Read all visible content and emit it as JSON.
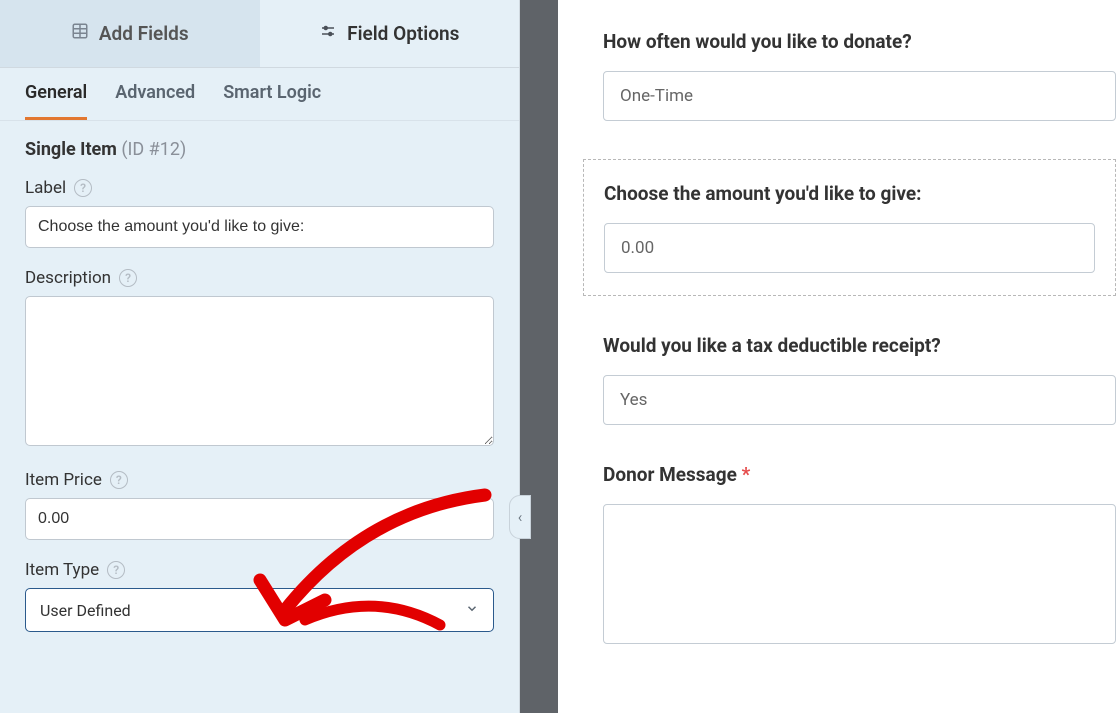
{
  "sidebar": {
    "topTabs": {
      "addFields": "Add Fields",
      "fieldOptions": "Field Options"
    },
    "subTabs": {
      "general": "General",
      "advanced": "Advanced",
      "smartLogic": "Smart Logic"
    },
    "fieldHeading": {
      "name": "Single Item",
      "id": "(ID #12)"
    },
    "labelGroup": {
      "label": "Label",
      "value": "Choose the amount you'd like to give:"
    },
    "descriptionGroup": {
      "label": "Description",
      "value": ""
    },
    "itemPriceGroup": {
      "label": "Item Price",
      "value": "0.00"
    },
    "itemTypeGroup": {
      "label": "Item Type",
      "value": "User Defined"
    }
  },
  "preview": {
    "frequency": {
      "label": "How often would you like to donate?",
      "value": "One-Time"
    },
    "amount": {
      "label": "Choose the amount you'd like to give:",
      "value": "0.00"
    },
    "taxReceipt": {
      "label": "Would you like a tax deductible receipt?",
      "value": "Yes"
    },
    "donorMessage": {
      "label": "Donor Message",
      "required": "*",
      "value": ""
    }
  }
}
